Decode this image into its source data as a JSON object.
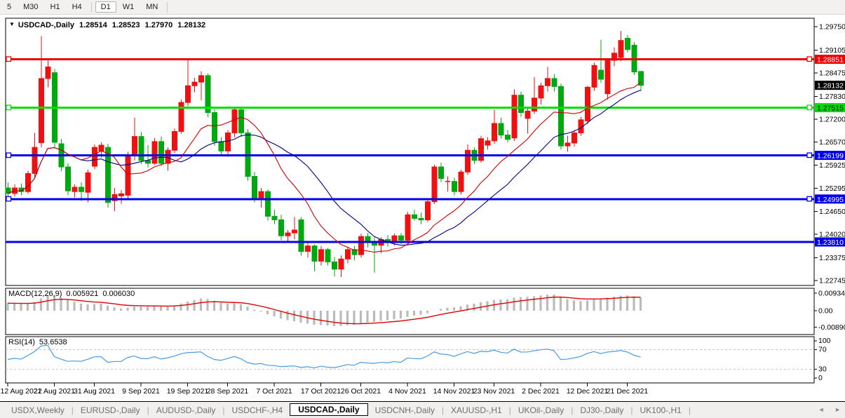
{
  "icons": {
    "title_arrow": "▼",
    "tab_scroll_left": "◄",
    "tab_scroll_right": "►"
  },
  "toolbar": {
    "items": [
      {
        "label": "5",
        "active": false
      },
      {
        "label": "M30",
        "active": false
      },
      {
        "label": "H1",
        "active": false
      },
      {
        "label": "H4",
        "active": false
      },
      {
        "label": "D1",
        "active": true
      },
      {
        "label": "W1",
        "active": false
      },
      {
        "label": "MN",
        "active": false
      }
    ]
  },
  "chart": {
    "symbol": "USDCAD-,Daily",
    "ohlc": {
      "open": "1.28514",
      "high": "1.28523",
      "low": "1.27970",
      "close": "1.28132"
    }
  },
  "chart_data": {
    "type": "candlestick",
    "title": "USDCAD-,Daily",
    "ylim": [
      1.2261,
      1.29944
    ],
    "bull_color": "#ee1111",
    "bear_color": "#00a810",
    "ma_fast": {
      "period": 12,
      "color": "#cc0000"
    },
    "ma_slow": {
      "period": 20,
      "color": "#000080"
    },
    "y_axis": [
      {
        "label": "1.29750",
        "value": 1.2975
      },
      {
        "label": "1.29105",
        "value": 1.29105
      },
      {
        "label": "1.28475",
        "value": 1.28475
      },
      {
        "label": "1.27830",
        "value": 1.2783
      },
      {
        "label": "1.27200",
        "value": 1.272
      },
      {
        "label": "1.26570",
        "value": 1.2657
      },
      {
        "label": "1.25925",
        "value": 1.25925
      },
      {
        "label": "1.25295",
        "value": 1.25295
      },
      {
        "label": "1.24650",
        "value": 1.2465
      },
      {
        "label": "1.24020",
        "value": 1.2402
      },
      {
        "label": "1.23375",
        "value": 1.23375
      },
      {
        "label": "1.22745",
        "value": 1.22745
      }
    ],
    "price_lines": [
      {
        "label": "1.28851",
        "value": 1.28851,
        "color": "#ee0000",
        "text_color": "#ffffff",
        "handles": true
      },
      {
        "label": "1.27515",
        "value": 1.27515,
        "color": "#00dd00",
        "text_color": "#000000",
        "handles": true
      },
      {
        "label": "1.26199",
        "value": 1.26199,
        "color": "#0000ee",
        "text_color": "#ffffff",
        "handles": true
      },
      {
        "label": "1.24995",
        "value": 1.24995,
        "color": "#0000ee",
        "text_color": "#ffffff",
        "handles": true
      },
      {
        "label": "1.23810",
        "value": 1.2381,
        "color": "#0000ee",
        "text_color": "#ffffff",
        "handles": false
      }
    ],
    "current_price": {
      "label": "1.28132",
      "value": 1.28132,
      "bg": "#000000",
      "text_color": "#ffffff"
    },
    "x_ticks": [
      {
        "label": "12 Aug 2021",
        "index": 0
      },
      {
        "label": "22 Aug 2021",
        "index": 7
      },
      {
        "label": "31 Aug 2021",
        "index": 13
      },
      {
        "label": "9 Sep 2021",
        "index": 20
      },
      {
        "label": "19 Sep 2021",
        "index": 27
      },
      {
        "label": "28 Sep 2021",
        "index": 33
      },
      {
        "label": "7 Oct 2021",
        "index": 40
      },
      {
        "label": "17 Oct 2021",
        "index": 47
      },
      {
        "label": "26 Oct 2021",
        "index": 53
      },
      {
        "label": "4 Nov 2021",
        "index": 60
      },
      {
        "label": "14 Nov 2021",
        "index": 67
      },
      {
        "label": "23 Nov 2021",
        "index": 73
      },
      {
        "label": "2 Dec 2021",
        "index": 80
      },
      {
        "label": "12 Dec 2021",
        "index": 87
      },
      {
        "label": "21 Dec 2021",
        "index": 93
      }
    ],
    "candles": [
      [
        1.253,
        1.2545,
        1.2505,
        1.2515
      ],
      [
        1.2515,
        1.254,
        1.2506,
        1.253
      ],
      [
        1.253,
        1.2542,
        1.251,
        1.252
      ],
      [
        1.252,
        1.2578,
        1.2514,
        1.257
      ],
      [
        1.257,
        1.2682,
        1.2558,
        1.2642
      ],
      [
        1.2655,
        1.2949,
        1.2642,
        1.2832
      ],
      [
        1.2832,
        1.2882,
        1.2808,
        1.2864
      ],
      [
        1.2848,
        1.2858,
        1.2642,
        1.2656
      ],
      [
        1.2652,
        1.2665,
        1.2576,
        1.2588
      ],
      [
        1.2588,
        1.2598,
        1.251,
        1.2522
      ],
      [
        1.252,
        1.254,
        1.2504,
        1.2532
      ],
      [
        1.2532,
        1.2546,
        1.2494,
        1.252
      ],
      [
        1.2518,
        1.258,
        1.249,
        1.2572
      ],
      [
        1.259,
        1.265,
        1.2582,
        1.2642
      ],
      [
        1.2632,
        1.2656,
        1.2614,
        1.2648
      ],
      [
        1.2642,
        1.2652,
        1.2476,
        1.249
      ],
      [
        1.2495,
        1.253,
        1.2466,
        1.2512
      ],
      [
        1.2508,
        1.2524,
        1.2486,
        1.2514
      ],
      [
        1.251,
        1.263,
        1.25,
        1.2622
      ],
      [
        1.2622,
        1.2724,
        1.2606,
        1.2672
      ],
      [
        1.2672,
        1.2684,
        1.2596,
        1.2606
      ],
      [
        1.2606,
        1.2648,
        1.2586,
        1.2598
      ],
      [
        1.2598,
        1.2668,
        1.2594,
        1.2658
      ],
      [
        1.2658,
        1.2672,
        1.259,
        1.2598
      ],
      [
        1.2598,
        1.2642,
        1.2578,
        1.2634
      ],
      [
        1.2634,
        1.2694,
        1.2626,
        1.2686
      ],
      [
        1.2686,
        1.2774,
        1.268,
        1.2766
      ],
      [
        1.2766,
        1.2888,
        1.2756,
        1.2812
      ],
      [
        1.2812,
        1.2834,
        1.2794,
        1.2822
      ],
      [
        1.2822,
        1.2852,
        1.2772,
        1.284
      ],
      [
        1.284,
        1.2846,
        1.2726,
        1.2738
      ],
      [
        1.2738,
        1.2748,
        1.2646,
        1.2658
      ],
      [
        1.2658,
        1.267,
        1.2618,
        1.2632
      ],
      [
        1.2632,
        1.269,
        1.2616,
        1.2682
      ],
      [
        1.2682,
        1.2752,
        1.267,
        1.2746
      ],
      [
        1.2746,
        1.2754,
        1.267,
        1.2682
      ],
      [
        1.2682,
        1.2692,
        1.255,
        1.2562
      ],
      [
        1.2562,
        1.2574,
        1.249,
        1.2502
      ],
      [
        1.2502,
        1.253,
        1.2476,
        1.252
      ],
      [
        1.252,
        1.2526,
        1.244,
        1.2452
      ],
      [
        1.2452,
        1.247,
        1.243,
        1.2442
      ],
      [
        1.2442,
        1.2456,
        1.2386,
        1.2398
      ],
      [
        1.2398,
        1.2414,
        1.238,
        1.2406
      ],
      [
        1.2406,
        1.245,
        1.2388,
        1.2414
      ],
      [
        1.2442,
        1.245,
        1.2343,
        1.2355
      ],
      [
        1.2355,
        1.238,
        1.2338,
        1.237
      ],
      [
        1.237,
        1.2374,
        1.23,
        1.2328
      ],
      [
        1.2328,
        1.237,
        1.2316,
        1.236
      ],
      [
        1.236,
        1.2364,
        1.2316,
        1.2326
      ],
      [
        1.2326,
        1.234,
        1.2286,
        1.2306
      ],
      [
        1.2306,
        1.2344,
        1.2284,
        1.2334
      ],
      [
        1.2334,
        1.2368,
        1.2322,
        1.236
      ],
      [
        1.236,
        1.237,
        1.233,
        1.2346
      ],
      [
        1.2346,
        1.2404,
        1.2338,
        1.2396
      ],
      [
        1.2396,
        1.2406,
        1.2366,
        1.238
      ],
      [
        1.238,
        1.2394,
        1.2296,
        1.2372
      ],
      [
        1.2372,
        1.2394,
        1.235,
        1.2388
      ],
      [
        1.2388,
        1.24,
        1.2368,
        1.238
      ],
      [
        1.238,
        1.2404,
        1.2372,
        1.2398
      ],
      [
        1.2398,
        1.2406,
        1.2376,
        1.2386
      ],
      [
        1.2386,
        1.2464,
        1.238,
        1.2456
      ],
      [
        1.2456,
        1.247,
        1.244,
        1.2446
      ],
      [
        1.2446,
        1.2462,
        1.243,
        1.2442
      ],
      [
        1.2442,
        1.2498,
        1.2436,
        1.2492
      ],
      [
        1.2492,
        1.2594,
        1.2486,
        1.2588
      ],
      [
        1.2588,
        1.26,
        1.2546,
        1.2556
      ],
      [
        1.2546,
        1.2562,
        1.252,
        1.2548
      ],
      [
        1.2548,
        1.2558,
        1.251,
        1.252
      ],
      [
        1.252,
        1.258,
        1.2512,
        1.2574
      ],
      [
        1.2574,
        1.265,
        1.2566,
        1.2634
      ],
      [
        1.2634,
        1.2642,
        1.2596,
        1.2606
      ],
      [
        1.2606,
        1.2674,
        1.26,
        1.2666
      ],
      [
        1.2648,
        1.267,
        1.2636,
        1.266
      ],
      [
        1.266,
        1.2746,
        1.2652,
        1.2708
      ],
      [
        1.2708,
        1.2724,
        1.2666,
        1.2676
      ],
      [
        1.2676,
        1.269,
        1.2656,
        1.2664
      ],
      [
        1.2668,
        1.2802,
        1.266,
        1.2786
      ],
      [
        1.2786,
        1.2796,
        1.2726,
        1.2738
      ],
      [
        1.2722,
        1.275,
        1.268,
        1.2742
      ],
      [
        1.2742,
        1.2836,
        1.2734,
        1.2778
      ],
      [
        1.2778,
        1.282,
        1.276,
        1.2812
      ],
      [
        1.2812,
        1.2864,
        1.2796,
        1.2832
      ],
      [
        1.2832,
        1.2844,
        1.2796,
        1.281
      ],
      [
        1.281,
        1.2818,
        1.2636,
        1.2646
      ],
      [
        1.2646,
        1.2674,
        1.263,
        1.2654
      ],
      [
        1.2654,
        1.269,
        1.2644,
        1.2682
      ],
      [
        1.2682,
        1.2726,
        1.2674,
        1.2718
      ],
      [
        1.2715,
        1.2812,
        1.2706,
        1.2808
      ],
      [
        1.2808,
        1.2876,
        1.2798,
        1.2868
      ],
      [
        1.2855,
        1.2939,
        1.282,
        1.283
      ],
      [
        1.279,
        1.2888,
        1.2774,
        1.2882
      ],
      [
        1.2882,
        1.2918,
        1.2866,
        1.2902
      ],
      [
        1.289,
        1.2963,
        1.288,
        1.2937
      ],
      [
        1.2943,
        1.2952,
        1.2904,
        1.2912
      ],
      [
        1.2924,
        1.2932,
        1.2842,
        1.285
      ],
      [
        1.28514,
        1.28523,
        1.2797,
        1.28132
      ]
    ],
    "macd": {
      "label": "MACD(12,26,9)",
      "value_main": "0.005921",
      "value_signal": "0.006030",
      "hist_color": "#bbbbbb",
      "signal_color": "#e00000",
      "axis": [
        {
          "label": "0.00934",
          "value": 0.009345
        },
        {
          "label": "0.00",
          "value": 0
        },
        {
          "label": "-0.00890",
          "value": -0.0089
        }
      ]
    },
    "rsi": {
      "label": "RSI(14)",
      "value": "53.6538",
      "color": "#4a9be6",
      "levels": [
        70,
        30
      ],
      "level_color": "#c4c4c4",
      "axis": [
        {
          "label": "100",
          "value": 100
        },
        {
          "label": "70",
          "value": 70
        },
        {
          "label": "30",
          "value": 30
        },
        {
          "label": "0",
          "value": 0
        }
      ]
    }
  },
  "tabs": {
    "items": [
      {
        "label": "USDX,Weekly",
        "active": false
      },
      {
        "label": "EURUSD-,Daily",
        "active": false
      },
      {
        "label": "AUDUSD-,Daily",
        "active": false
      },
      {
        "label": "USDCHF-,H4",
        "active": false
      },
      {
        "label": "USDCAD-,Daily",
        "active": true
      },
      {
        "label": "USDCNH-,Daily",
        "active": false
      },
      {
        "label": "XAUUSD-,H1",
        "active": false
      },
      {
        "label": "UKOil-,Daily",
        "active": false
      },
      {
        "label": "DJ30-,Daily",
        "active": false
      },
      {
        "label": "UK100-,H1",
        "active": false
      }
    ]
  }
}
